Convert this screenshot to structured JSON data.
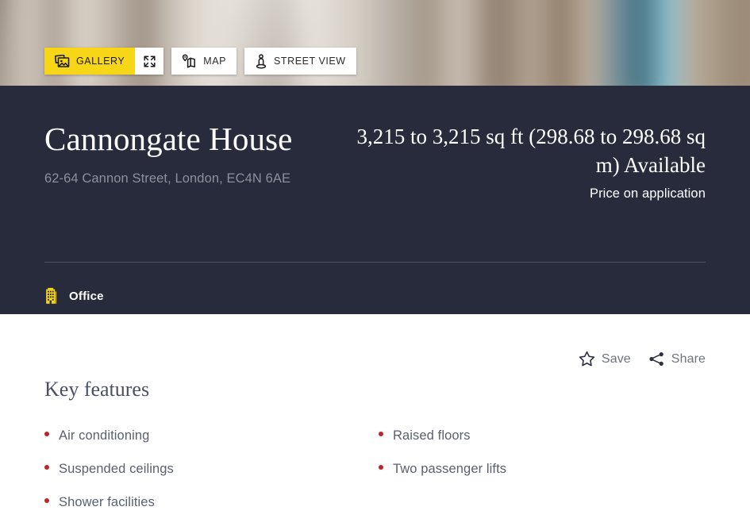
{
  "hero": {
    "controls": [
      {
        "id": "gallery",
        "label": "GALLERY",
        "icon": "gallery-photos-icon",
        "active": true
      },
      {
        "id": "expand",
        "label": "",
        "icon": "expand-fullscreen-icon",
        "active": false
      },
      {
        "id": "map",
        "label": "MAP",
        "icon": "map-pin-icon",
        "active": false
      },
      {
        "id": "street-view",
        "label": "STREET VIEW",
        "icon": "street-view-pegman-icon",
        "active": false
      }
    ]
  },
  "header": {
    "title": "Cannongate House",
    "address": "62-64 Cannon Street, London, EC4N 6AE",
    "size": "3,215 to 3,215 sq ft (298.68 to 298.68 sq m) Available",
    "price": "Price on application",
    "tag": {
      "label": "Office",
      "icon": "office-building-icon"
    }
  },
  "actions": [
    {
      "id": "save",
      "label": "Save",
      "icon": "star-outline-icon"
    },
    {
      "id": "share",
      "label": "Share",
      "icon": "share-nodes-icon"
    }
  ],
  "key_features": {
    "title": "Key features",
    "items": [
      "Air conditioning",
      "Raised floors",
      "Suspended ceilings",
      "Two passenger lifts",
      "Shower facilities"
    ]
  },
  "colors": {
    "accent_yellow": "#f7d618",
    "dark_navy": "#272b3c",
    "bullet_red": "#c0232c",
    "muted_grey": "#8c909c"
  }
}
